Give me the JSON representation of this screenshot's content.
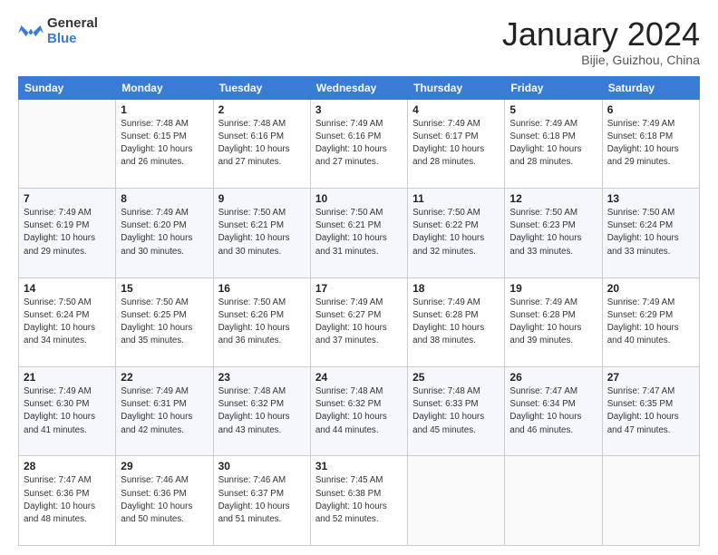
{
  "logo": {
    "general": "General",
    "blue": "Blue"
  },
  "title": {
    "month_year": "January 2024",
    "location": "Bijie, Guizhou, China"
  },
  "weekdays": [
    "Sunday",
    "Monday",
    "Tuesday",
    "Wednesday",
    "Thursday",
    "Friday",
    "Saturday"
  ],
  "weeks": [
    [
      {
        "day": "",
        "detail": ""
      },
      {
        "day": "1",
        "detail": "Sunrise: 7:48 AM\nSunset: 6:15 PM\nDaylight: 10 hours\nand 26 minutes."
      },
      {
        "day": "2",
        "detail": "Sunrise: 7:48 AM\nSunset: 6:16 PM\nDaylight: 10 hours\nand 27 minutes."
      },
      {
        "day": "3",
        "detail": "Sunrise: 7:49 AM\nSunset: 6:16 PM\nDaylight: 10 hours\nand 27 minutes."
      },
      {
        "day": "4",
        "detail": "Sunrise: 7:49 AM\nSunset: 6:17 PM\nDaylight: 10 hours\nand 28 minutes."
      },
      {
        "day": "5",
        "detail": "Sunrise: 7:49 AM\nSunset: 6:18 PM\nDaylight: 10 hours\nand 28 minutes."
      },
      {
        "day": "6",
        "detail": "Sunrise: 7:49 AM\nSunset: 6:18 PM\nDaylight: 10 hours\nand 29 minutes."
      }
    ],
    [
      {
        "day": "7",
        "detail": "Sunrise: 7:49 AM\nSunset: 6:19 PM\nDaylight: 10 hours\nand 29 minutes."
      },
      {
        "day": "8",
        "detail": "Sunrise: 7:49 AM\nSunset: 6:20 PM\nDaylight: 10 hours\nand 30 minutes."
      },
      {
        "day": "9",
        "detail": "Sunrise: 7:50 AM\nSunset: 6:21 PM\nDaylight: 10 hours\nand 30 minutes."
      },
      {
        "day": "10",
        "detail": "Sunrise: 7:50 AM\nSunset: 6:21 PM\nDaylight: 10 hours\nand 31 minutes."
      },
      {
        "day": "11",
        "detail": "Sunrise: 7:50 AM\nSunset: 6:22 PM\nDaylight: 10 hours\nand 32 minutes."
      },
      {
        "day": "12",
        "detail": "Sunrise: 7:50 AM\nSunset: 6:23 PM\nDaylight: 10 hours\nand 33 minutes."
      },
      {
        "day": "13",
        "detail": "Sunrise: 7:50 AM\nSunset: 6:24 PM\nDaylight: 10 hours\nand 33 minutes."
      }
    ],
    [
      {
        "day": "14",
        "detail": "Sunrise: 7:50 AM\nSunset: 6:24 PM\nDaylight: 10 hours\nand 34 minutes."
      },
      {
        "day": "15",
        "detail": "Sunrise: 7:50 AM\nSunset: 6:25 PM\nDaylight: 10 hours\nand 35 minutes."
      },
      {
        "day": "16",
        "detail": "Sunrise: 7:50 AM\nSunset: 6:26 PM\nDaylight: 10 hours\nand 36 minutes."
      },
      {
        "day": "17",
        "detail": "Sunrise: 7:49 AM\nSunset: 6:27 PM\nDaylight: 10 hours\nand 37 minutes."
      },
      {
        "day": "18",
        "detail": "Sunrise: 7:49 AM\nSunset: 6:28 PM\nDaylight: 10 hours\nand 38 minutes."
      },
      {
        "day": "19",
        "detail": "Sunrise: 7:49 AM\nSunset: 6:28 PM\nDaylight: 10 hours\nand 39 minutes."
      },
      {
        "day": "20",
        "detail": "Sunrise: 7:49 AM\nSunset: 6:29 PM\nDaylight: 10 hours\nand 40 minutes."
      }
    ],
    [
      {
        "day": "21",
        "detail": "Sunrise: 7:49 AM\nSunset: 6:30 PM\nDaylight: 10 hours\nand 41 minutes."
      },
      {
        "day": "22",
        "detail": "Sunrise: 7:49 AM\nSunset: 6:31 PM\nDaylight: 10 hours\nand 42 minutes."
      },
      {
        "day": "23",
        "detail": "Sunrise: 7:48 AM\nSunset: 6:32 PM\nDaylight: 10 hours\nand 43 minutes."
      },
      {
        "day": "24",
        "detail": "Sunrise: 7:48 AM\nSunset: 6:32 PM\nDaylight: 10 hours\nand 44 minutes."
      },
      {
        "day": "25",
        "detail": "Sunrise: 7:48 AM\nSunset: 6:33 PM\nDaylight: 10 hours\nand 45 minutes."
      },
      {
        "day": "26",
        "detail": "Sunrise: 7:47 AM\nSunset: 6:34 PM\nDaylight: 10 hours\nand 46 minutes."
      },
      {
        "day": "27",
        "detail": "Sunrise: 7:47 AM\nSunset: 6:35 PM\nDaylight: 10 hours\nand 47 minutes."
      }
    ],
    [
      {
        "day": "28",
        "detail": "Sunrise: 7:47 AM\nSunset: 6:36 PM\nDaylight: 10 hours\nand 48 minutes."
      },
      {
        "day": "29",
        "detail": "Sunrise: 7:46 AM\nSunset: 6:36 PM\nDaylight: 10 hours\nand 50 minutes."
      },
      {
        "day": "30",
        "detail": "Sunrise: 7:46 AM\nSunset: 6:37 PM\nDaylight: 10 hours\nand 51 minutes."
      },
      {
        "day": "31",
        "detail": "Sunrise: 7:45 AM\nSunset: 6:38 PM\nDaylight: 10 hours\nand 52 minutes."
      },
      {
        "day": "",
        "detail": ""
      },
      {
        "day": "",
        "detail": ""
      },
      {
        "day": "",
        "detail": ""
      }
    ]
  ]
}
